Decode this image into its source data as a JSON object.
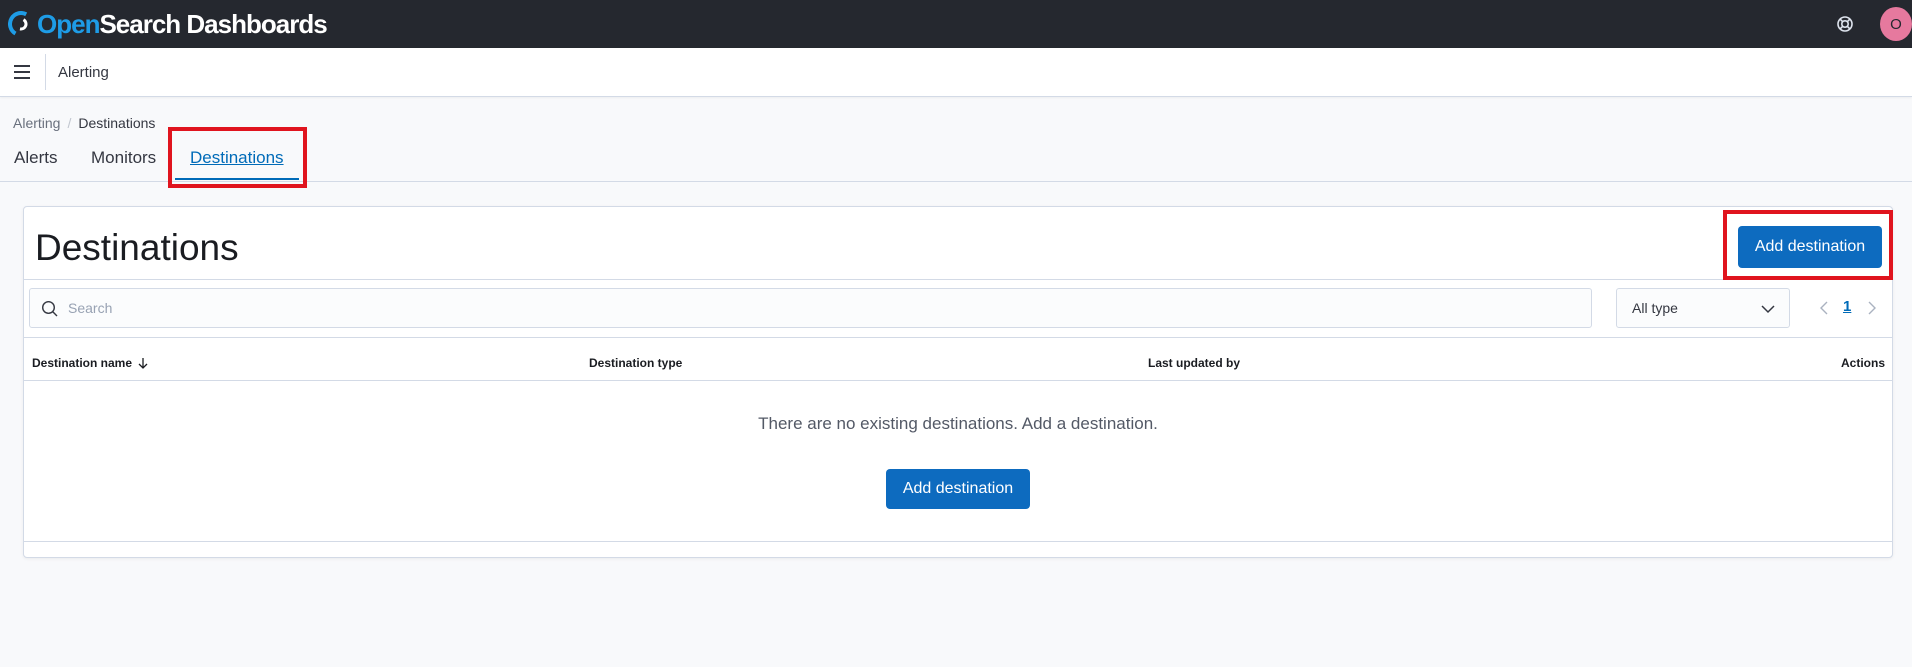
{
  "header": {
    "logo_open": "Open",
    "logo_rest": "Search Dashboards",
    "help_icon": "help-icon",
    "avatar_initial": "O"
  },
  "navbar": {
    "menu_icon": "hamburger-menu-icon",
    "title": "Alerting"
  },
  "breadcrumb": [
    {
      "label": "Alerting"
    },
    {
      "label": "Destinations"
    }
  ],
  "breadcrumb_separator": "/",
  "tabs": [
    {
      "label": "Alerts",
      "selected": false
    },
    {
      "label": "Monitors",
      "selected": false
    },
    {
      "label": "Destinations",
      "selected": true
    }
  ],
  "panel": {
    "title": "Destinations",
    "add_button": "Add destination"
  },
  "search": {
    "placeholder": "Search",
    "value": ""
  },
  "type_filter": {
    "selected": "All type"
  },
  "pagination": {
    "current_page": "1"
  },
  "table": {
    "columns": [
      "Destination name",
      "Destination type",
      "Last updated by",
      "Actions"
    ],
    "sort_icon": "arrow-down-icon",
    "rows": [],
    "empty_message": "There are no existing destinations. Add a destination.",
    "empty_button": "Add destination"
  },
  "colors": {
    "header_bg": "#25282f",
    "accent": "#006bb8",
    "primary_button": "#0d6bbf",
    "highlight": "#e0141e",
    "avatar": "#e6799e"
  }
}
